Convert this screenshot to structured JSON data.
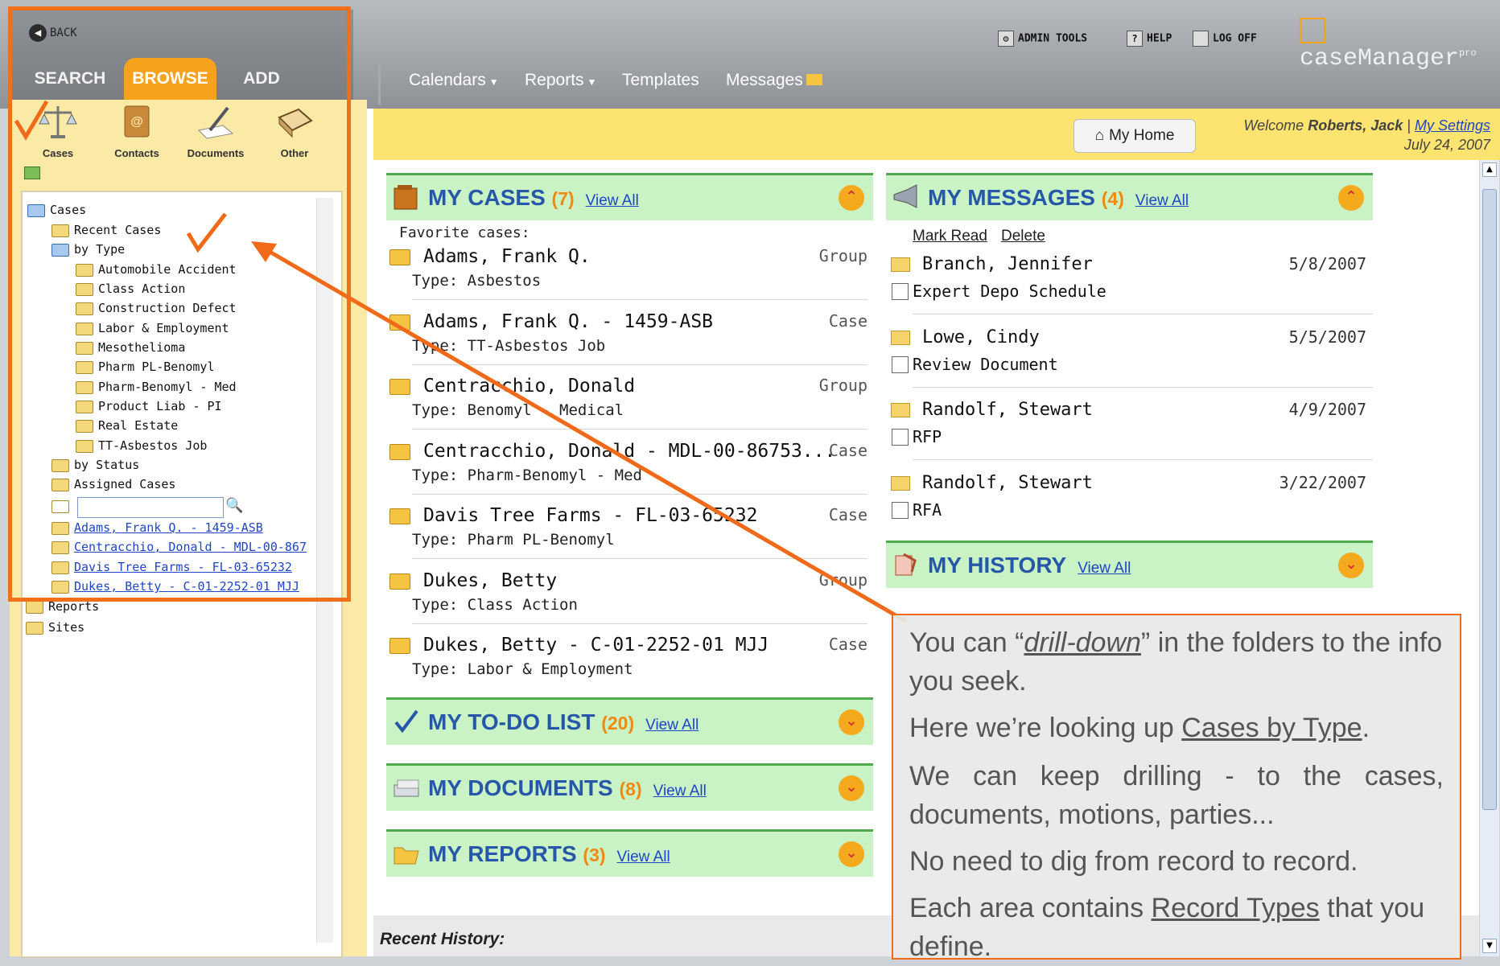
{
  "nav": {
    "back": "BACK",
    "tabs": [
      "SEARCH",
      "BROWSE",
      "ADD"
    ],
    "menu": [
      "Calendars",
      "Reports",
      "Templates",
      "Messages"
    ],
    "utilities": [
      "ADMIN TOOLS",
      "HELP",
      "LOG OFF"
    ],
    "logo": "caseManager",
    "logo_sup": "pro"
  },
  "categories": [
    "Cases",
    "Contacts",
    "Documents",
    "Other"
  ],
  "tree": {
    "root": "Cases",
    "items": [
      "Recent Cases",
      "by Type",
      "Automobile Accident",
      "Class Action",
      "Construction Defect",
      "Labor & Employment",
      "Mesothelioma",
      "Pharm PL-Benomyl",
      "Pharm-Benomyl - Med",
      "Product Liab - PI",
      "Real Estate",
      "TT-Asbestos Job",
      "by Status",
      "Assigned Cases"
    ],
    "links": [
      "Adams, Frank Q. - 1459-ASB",
      "Centracchio, Donald - MDL-00-867",
      "Davis Tree Farms - FL-03-65232",
      "Dukes, Betty - C-01-2252-01 MJJ"
    ],
    "bottom": [
      "Reports",
      "Sites"
    ]
  },
  "header": {
    "my_home": "My Home",
    "welcome_prefix": "Welcome ",
    "user": "Roberts, Jack",
    "separator": " | ",
    "settings": "My Settings",
    "date": "July 24, 2007"
  },
  "cases": {
    "title": "MY CASES",
    "count": "(7)",
    "view_all": "View All",
    "favorite_label": "Favorite cases:",
    "rows": [
      {
        "name": "Adams, Frank Q.",
        "type": "Type: Asbestos",
        "kind": "Group"
      },
      {
        "name": "Adams, Frank Q. - 1459-ASB",
        "type": "Type: TT-Asbestos Job",
        "kind": "Case"
      },
      {
        "name": "Centracchio, Donald",
        "type": "Type: Benomyl - Medical",
        "kind": "Group"
      },
      {
        "name": "Centracchio, Donald - MDL-00-86753...",
        "type": "Type: Pharm-Benomyl - Med",
        "kind": "Case"
      },
      {
        "name": "Davis Tree Farms - FL-03-65232",
        "type": "Type: Pharm PL-Benomyl",
        "kind": "Case"
      },
      {
        "name": "Dukes, Betty",
        "type": "Type: Class Action",
        "kind": "Group"
      },
      {
        "name": "Dukes, Betty - C-01-2252-01 MJJ",
        "type": "Type: Labor & Employment",
        "kind": "Case"
      }
    ]
  },
  "panels": [
    {
      "title": "MY TO-DO LIST",
      "count": "(20)",
      "view_all": "View All"
    },
    {
      "title": "MY DOCUMENTS",
      "count": "(8)",
      "view_all": "View All"
    },
    {
      "title": "MY REPORTS",
      "count": "(3)",
      "view_all": "View All"
    }
  ],
  "messages": {
    "title": "MY MESSAGES",
    "count": "(4)",
    "view_all": "View All",
    "mark_read": "Mark Read",
    "delete": "Delete",
    "rows": [
      {
        "from": "Branch, Jennifer",
        "date": "5/8/2007",
        "subject": "Expert Depo Schedule"
      },
      {
        "from": "Lowe, Cindy",
        "date": "5/5/2007",
        "subject": "Review Document"
      },
      {
        "from": "Randolf, Stewart",
        "date": "4/9/2007",
        "subject": "RFP"
      },
      {
        "from": "Randolf, Stewart",
        "date": "3/22/2007",
        "subject": "RFA"
      }
    ]
  },
  "history": {
    "title": "MY HISTORY",
    "view_all": "View All"
  },
  "recent_history": "Recent History:",
  "callout": {
    "p1_a": "You can “",
    "p1_u": "drill-down",
    "p1_b": "” in the folders to the info you seek.",
    "p2_a": "Here we’re looking up ",
    "p2_u": "Cases by Type",
    "p2_b": ".",
    "p3": "We can keep drilling - to the cases, documents, motions, parties...",
    "p4": "No need to dig from record to record.",
    "p5_a": "Each area contains ",
    "p5_u": "Record Types",
    "p5_b": " that you define."
  },
  "colors": {
    "accent": "#f08a11",
    "callout_border": "#f06a1a",
    "panel_green": "#c9f2c5",
    "title_blue": "#2657a8"
  }
}
